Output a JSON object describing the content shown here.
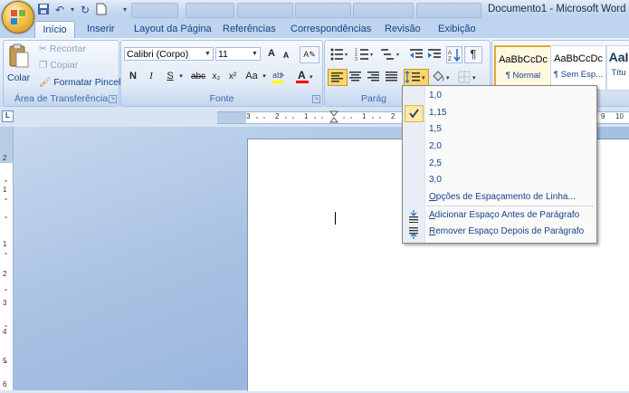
{
  "window": {
    "title": "Documento1 - Microsoft Word"
  },
  "tabs": [
    {
      "label": "Início"
    },
    {
      "label": "Inserir"
    },
    {
      "label": "Layout da Página"
    },
    {
      "label": "Referências"
    },
    {
      "label": "Correspondências"
    },
    {
      "label": "Revisão"
    },
    {
      "label": "Exibição"
    }
  ],
  "clipboard": {
    "paste_label": "Colar",
    "cut_label": "Recortar",
    "copy_label": "Copiar",
    "format_painter_label": "Formatar Pincel",
    "group_label": "Área de Transferência"
  },
  "font": {
    "font_name": "Calibri (Corpo)",
    "font_size": "11",
    "bold": "N",
    "italic": "I",
    "underline": "S",
    "strikethrough": "abc",
    "subscript": "x₂",
    "superscript": "x²",
    "change_case": "Aa",
    "grow": "A",
    "shrink": "A",
    "group_label": "Fonte",
    "highlight_color": "#ffff00",
    "font_color": "#ff0000"
  },
  "paragraph": {
    "group_label": "Parág"
  },
  "styles": [
    {
      "preview": "AaBbCcDc",
      "name": "¶ Normal"
    },
    {
      "preview": "AaBbCcDc",
      "name": "¶ Sem Esp..."
    },
    {
      "preview": "AaI",
      "name": "Títu"
    }
  ],
  "line_spacing_menu": {
    "options": [
      "1,0",
      "1,15",
      "1,5",
      "2,0",
      "2,5",
      "3,0"
    ],
    "selected": "1,15",
    "options_label": "Opções de Espaçamento de Linha...",
    "add_before_label": "Adicionar Espaço Antes de Parágrafo",
    "remove_after_label": "Remover Espaço Depois de Parágrafo"
  },
  "ruler": {
    "h_numbers": [
      "3",
      "2",
      "1",
      "1",
      "2"
    ],
    "h_numbers_right": [
      "9",
      "10"
    ],
    "v_numbers": [
      "2",
      "1",
      "1",
      "2",
      "3",
      "4",
      "5",
      "6"
    ]
  },
  "colors": {
    "ribbon_text": "#15428b",
    "tab_active_bg": "#ffffff",
    "menu_check_bg": "#fde8a8"
  }
}
